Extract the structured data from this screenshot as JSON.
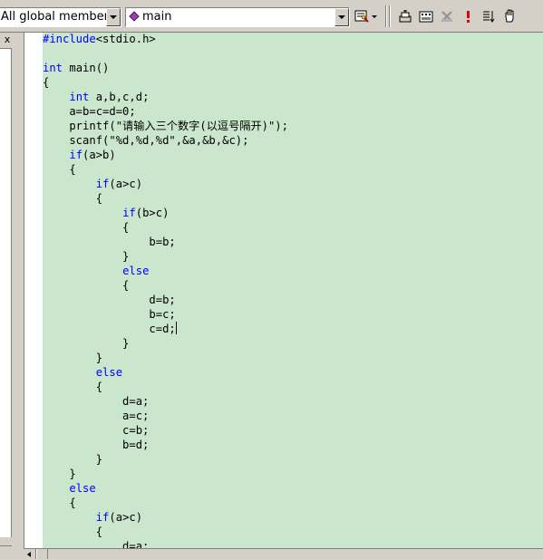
{
  "toolbar": {
    "members_combo": "All global members",
    "function_combo": "main",
    "icons": [
      "wizard-icon",
      "compile-icon",
      "build-icon",
      "stop-build-icon",
      "execute-icon",
      "insert-breakpoint-icon",
      "go-icon"
    ]
  },
  "left_panel": {
    "close_label": "x"
  },
  "editor": {
    "colors": {
      "background": "#cae6cc",
      "keyword": "#0000ff",
      "text": "#000000"
    },
    "lines": [
      [
        {
          "t": "#include",
          "k": 1
        },
        {
          "t": "<stdio.h>"
        }
      ],
      [],
      [
        {
          "t": "int",
          "k": 1
        },
        {
          "t": " main()"
        }
      ],
      [
        {
          "t": "{"
        }
      ],
      [
        {
          "t": "    "
        },
        {
          "t": "int",
          "k": 1
        },
        {
          "t": " a,b,c,d;"
        }
      ],
      [
        {
          "t": "    a=b=c=d=0;"
        }
      ],
      [
        {
          "t": "    printf(\"请输入三个数字(以逗号隔开)\");"
        }
      ],
      [
        {
          "t": "    scanf(\"%d,%d,%d\",&a,&b,&c);"
        }
      ],
      [
        {
          "t": "    "
        },
        {
          "t": "if",
          "k": 1
        },
        {
          "t": "(a>b)"
        }
      ],
      [
        {
          "t": "    {"
        }
      ],
      [
        {
          "t": "        "
        },
        {
          "t": "if",
          "k": 1
        },
        {
          "t": "(a>c)"
        }
      ],
      [
        {
          "t": "        {"
        }
      ],
      [
        {
          "t": "            "
        },
        {
          "t": "if",
          "k": 1
        },
        {
          "t": "(b>c)"
        }
      ],
      [
        {
          "t": "            {"
        }
      ],
      [
        {
          "t": "                b=b;"
        }
      ],
      [
        {
          "t": "            }"
        }
      ],
      [
        {
          "t": "            "
        },
        {
          "t": "else",
          "k": 1
        }
      ],
      [
        {
          "t": "            {"
        }
      ],
      [
        {
          "t": "                d=b;"
        }
      ],
      [
        {
          "t": "                b=c;"
        }
      ],
      [
        {
          "t": "                c=d;"
        },
        {
          "caret": 1
        }
      ],
      [
        {
          "t": "            }"
        }
      ],
      [
        {
          "t": "        }"
        }
      ],
      [
        {
          "t": "        "
        },
        {
          "t": "else",
          "k": 1
        }
      ],
      [
        {
          "t": "        {"
        }
      ],
      [
        {
          "t": "            d=a;"
        }
      ],
      [
        {
          "t": "            a=c;"
        }
      ],
      [
        {
          "t": "            c=b;"
        }
      ],
      [
        {
          "t": "            b=d;"
        }
      ],
      [
        {
          "t": "        }"
        }
      ],
      [
        {
          "t": "    }"
        }
      ],
      [
        {
          "t": "    "
        },
        {
          "t": "else",
          "k": 1
        }
      ],
      [
        {
          "t": "    {"
        }
      ],
      [
        {
          "t": "        "
        },
        {
          "t": "if",
          "k": 1
        },
        {
          "t": "(a>c)"
        }
      ],
      [
        {
          "t": "        {"
        }
      ],
      [
        {
          "t": "            d=a;"
        }
      ]
    ]
  }
}
